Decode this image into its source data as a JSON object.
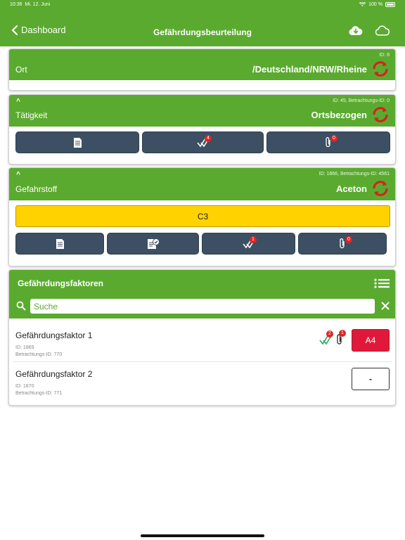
{
  "status_bar": {
    "time": "10:36",
    "date": "Mi. 12. Juni",
    "battery": "100 %"
  },
  "nav": {
    "back_label": "Dashboard",
    "title": "Gefährdungsbeurteilung"
  },
  "ort": {
    "meta": "ID: 8",
    "label": "Ort",
    "value": "/Deutschland/NRW/Rheine"
  },
  "taetigkeit": {
    "meta": "ID: 45, Betrachtungs-ID: 0",
    "label": "Tätigkeit",
    "value": "Ortsbezogen",
    "check_count": "4",
    "attach_count": "0"
  },
  "gefahrstoff": {
    "meta": "ID: 1866, Betrachtungs-ID: 4561",
    "label": "Gefahrstoff",
    "value": "Aceton",
    "classification": "C3",
    "check_count": "1",
    "attach_count": "0"
  },
  "factors": {
    "title": "Gefährdungsfaktoren",
    "search_placeholder": "Suche",
    "items": [
      {
        "name": "Gefährdungsfaktor 1",
        "id": "ID:  1869",
        "betrachtungs_id": "Betrachtungs-ID:  770",
        "check_count": "2",
        "attach_count": "1",
        "rating": "A4"
      },
      {
        "name": "Gefährdungsfaktor 2",
        "id": "ID:  1870",
        "betrachtungs_id": "Betrachtungs-ID:  771",
        "rating": "-"
      }
    ]
  },
  "colors": {
    "primary": "#5aaa2f",
    "button": "#3c4f63",
    "warning": "#ffd200",
    "danger": "#e0193a",
    "badge": "#e02424"
  }
}
